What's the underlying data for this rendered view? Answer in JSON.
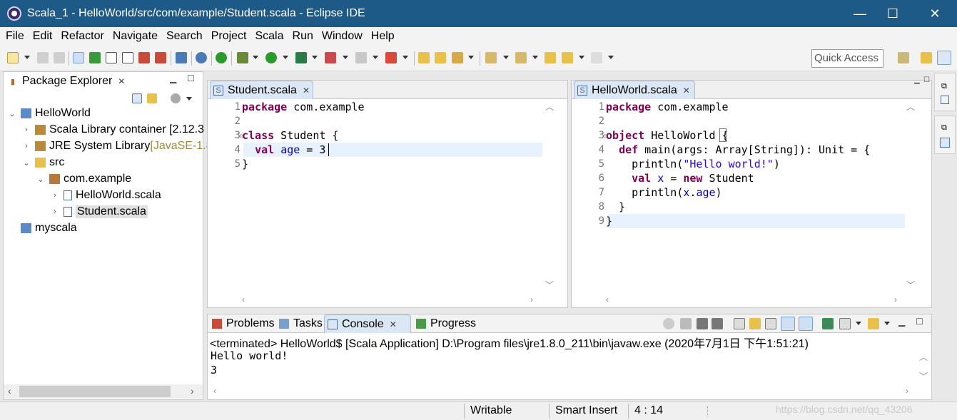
{
  "window": {
    "title": "Scala_1 - HelloWorld/src/com/example/Student.scala - Eclipse IDE",
    "minimize": "—",
    "maximize": "☐",
    "close": "✕"
  },
  "menu": [
    "File",
    "Edit",
    "Refactor",
    "Navigate",
    "Search",
    "Project",
    "Scala",
    "Run",
    "Window",
    "Help"
  ],
  "toolbar": {
    "quick_access": "Quick Access"
  },
  "package_explorer": {
    "tab_label": "Package Explorer",
    "tree": [
      {
        "label": "HelloWorld",
        "level": 0,
        "expanded": true,
        "icon": "project-icon"
      },
      {
        "label": "Scala Library container [2.12.3",
        "level": 1,
        "expanded": false,
        "icon": "library-icon"
      },
      {
        "label": "JRE System Library ",
        "decoration": "[JavaSE-1.8",
        "level": 1,
        "expanded": false,
        "icon": "library-icon"
      },
      {
        "label": "src",
        "level": 1,
        "expanded": true,
        "icon": "source-folder-icon"
      },
      {
        "label": "com.example",
        "level": 2,
        "expanded": true,
        "icon": "package-icon"
      },
      {
        "label": "HelloWorld.scala",
        "level": 3,
        "expanded": false,
        "icon": "scala-file-icon"
      },
      {
        "label": "Student.scala",
        "level": 3,
        "expanded": false,
        "icon": "scala-file-icon",
        "selected": true
      },
      {
        "label": "myscala",
        "level": 0,
        "expanded": false,
        "icon": "project-icon"
      }
    ]
  },
  "editor_left": {
    "tab_label": "Student.scala",
    "line_numbers": [
      "1",
      "2",
      "3",
      "4",
      "5"
    ],
    "lines": [
      [
        {
          "t": "package",
          "c": "kw"
        },
        {
          "t": " com.example",
          "c": ""
        }
      ],
      [],
      [
        {
          "t": "class",
          "c": "kw"
        },
        {
          "t": " Student {",
          "c": ""
        }
      ],
      [
        {
          "t": "  ",
          "c": ""
        },
        {
          "t": "val",
          "c": "kw"
        },
        {
          "t": " ",
          "c": ""
        },
        {
          "t": "age",
          "c": "var"
        },
        {
          "t": " = 3",
          "c": ""
        }
      ],
      [
        {
          "t": "}",
          "c": ""
        }
      ]
    ]
  },
  "editor_right": {
    "tab_label": "HelloWorld.scala",
    "line_numbers": [
      "1",
      "2",
      "3",
      "4",
      "5",
      "6",
      "7",
      "8",
      "9"
    ],
    "lines": [
      [
        {
          "t": "package",
          "c": "kw"
        },
        {
          "t": " com.example",
          "c": ""
        }
      ],
      [],
      [
        {
          "t": "object",
          "c": "kw"
        },
        {
          "t": " HelloWorld {",
          "c": ""
        }
      ],
      [
        {
          "t": "  ",
          "c": ""
        },
        {
          "t": "def",
          "c": "kw"
        },
        {
          "t": " main(args: Array[String]): Unit = {",
          "c": ""
        }
      ],
      [
        {
          "t": "    println(",
          "c": ""
        },
        {
          "t": "\"Hello world!\"",
          "c": "str"
        },
        {
          "t": ")",
          "c": ""
        }
      ],
      [
        {
          "t": "    ",
          "c": ""
        },
        {
          "t": "val",
          "c": "kw"
        },
        {
          "t": " ",
          "c": ""
        },
        {
          "t": "x",
          "c": "var"
        },
        {
          "t": " = ",
          "c": ""
        },
        {
          "t": "new",
          "c": "kw"
        },
        {
          "t": " Student",
          "c": ""
        }
      ],
      [
        {
          "t": "    println(",
          "c": ""
        },
        {
          "t": "x",
          "c": "var"
        },
        {
          "t": ".",
          "c": ""
        },
        {
          "t": "age",
          "c": "var"
        },
        {
          "t": ")",
          "c": ""
        }
      ],
      [
        {
          "t": "  }",
          "c": ""
        }
      ],
      [
        {
          "t": "}",
          "c": ""
        }
      ]
    ]
  },
  "bottom_panel": {
    "tabs": [
      "Problems",
      "Tasks",
      "Console",
      "Progress"
    ],
    "active_tab": "Console",
    "console_header": "<terminated> HelloWorld$ [Scala Application] D:\\Program files\\jre1.8.0_211\\bin\\javaw.exe (2020年7月1日 下午1:51:21)",
    "console_output": [
      "Hello world!",
      "3"
    ]
  },
  "status_bar": {
    "writable": "Writable",
    "insert_mode": "Smart Insert",
    "position": "4 : 14"
  },
  "watermark": "https://blog.csdn.net/qq_43206"
}
